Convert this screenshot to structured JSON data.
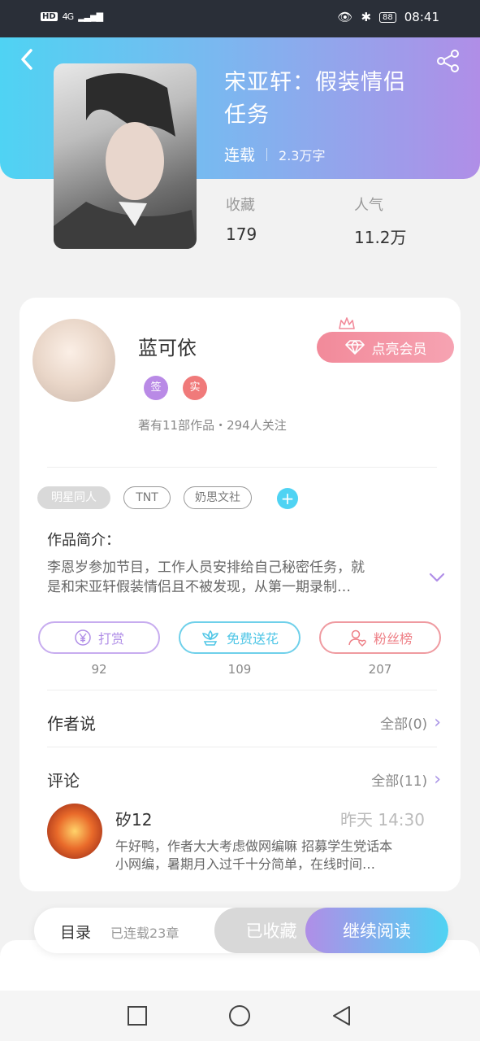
{
  "status_bar": {
    "hd": "HD",
    "network": "4G",
    "battery": "88",
    "time": "08:41"
  },
  "book": {
    "title_line1": "宋亚轩：假装情侣",
    "title_line2": "任务",
    "status": "连载",
    "word_count": "2.3万字",
    "stats": [
      {
        "label": "收藏",
        "value": "179"
      },
      {
        "label": "人气",
        "value": "11.2万"
      }
    ]
  },
  "author": {
    "name": "蓝可依",
    "badges": [
      "签",
      "实"
    ],
    "info": "著有11部作品・294人关注",
    "vip_label": "点亮会员"
  },
  "tags": [
    "明星同人",
    "TNT",
    "奶思文社"
  ],
  "intro": {
    "label": "作品简介：",
    "line1": "李恩岁参加节目，工作人员安排给自己秘密任务，就",
    "line2": "是和宋亚轩假装情侣且不被发现，从第一期录制…"
  },
  "actions": [
    {
      "label": "打赏",
      "count": "92",
      "color": "#b08ee7"
    },
    {
      "label": "免费送花",
      "count": "109",
      "color": "#4fc6e6"
    },
    {
      "label": "粉丝榜",
      "count": "207",
      "color": "#ee7f86"
    }
  ],
  "author_says": {
    "title": "作者说",
    "more": "全部(0)"
  },
  "comments": {
    "title": "评论",
    "more": "全部(11)",
    "first": {
      "user": "矽12",
      "time": "昨天 14:30",
      "line1": "午好鸭，作者大大考虑做网编嘛 招募学生党话本",
      "line2": "小网编，暑期月入过千十分简单，在线时间…"
    }
  },
  "bottom_bar": {
    "toc_label": "目录",
    "toc_sub": "已连载23章",
    "fav_label": "已收藏",
    "read_label": "继续阅读"
  },
  "icons": {
    "back": "back-chevron-icon",
    "share": "share-icon",
    "vip": "diamond-icon",
    "crown": "crown-icon",
    "tip": "yen-coin-icon",
    "flower": "flower-icon",
    "fans": "user-heart-icon",
    "expand": "chevron-down-icon",
    "nav_recent": "square-icon",
    "nav_home": "circle-icon",
    "nav_back": "triangle-back-icon"
  },
  "colors": {
    "accent_cyan": "#4fd3f3",
    "accent_purple": "#b08ee7",
    "vip_pink": "#f28a9a"
  }
}
